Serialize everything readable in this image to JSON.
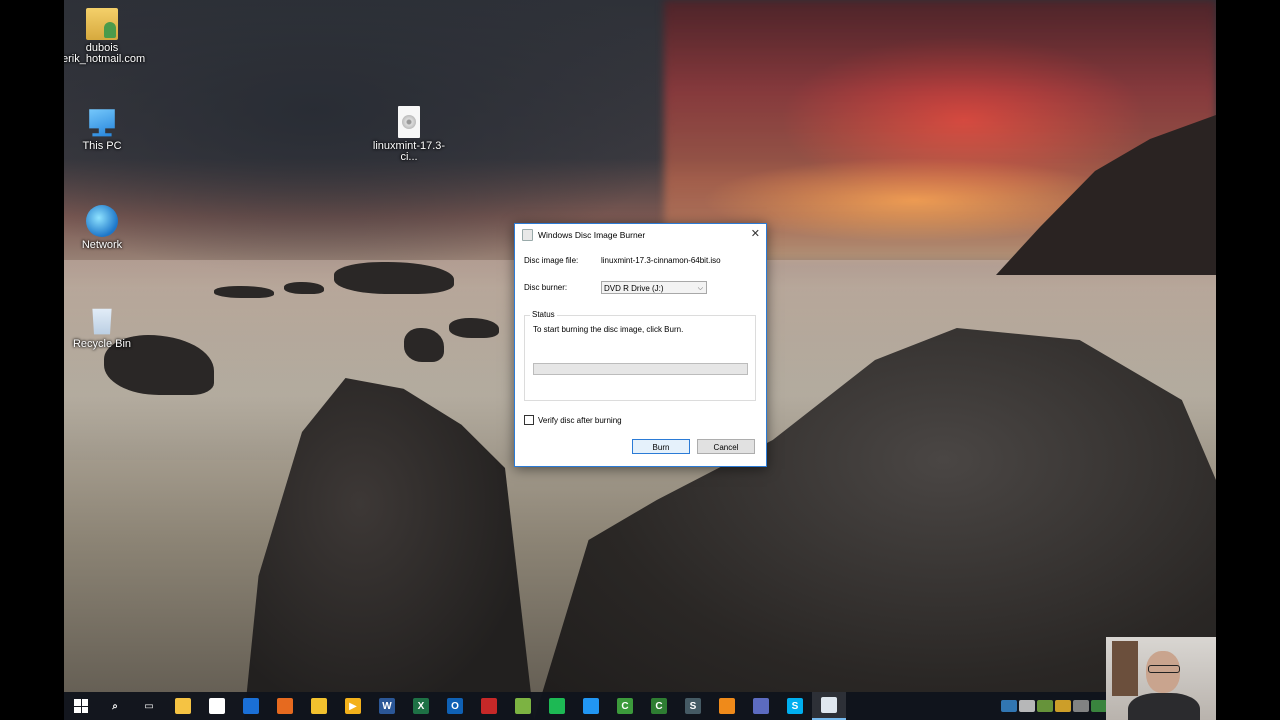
{
  "desktop": {
    "icons": [
      {
        "label": "dubois\nerik_hotmail.com",
        "line1": "dubois",
        "line2": "erik_hotmail.com",
        "icon": "user-folder-icon"
      },
      {
        "label": "This PC",
        "icon": "computer-icon"
      },
      {
        "label": "Network",
        "icon": "network-icon"
      },
      {
        "label": "Recycle Bin",
        "icon": "recycle-bin-icon"
      },
      {
        "label": "linuxmint-17.3-ci...",
        "icon": "disc-image-icon"
      }
    ]
  },
  "dialog": {
    "title": "Windows Disc Image Burner",
    "disc_image_label": "Disc image file:",
    "disc_image_value": "linuxmint-17.3-cinnamon-64bit.iso",
    "disc_burner_label": "Disc burner:",
    "disc_burner_value": "DVD R Drive (J:)",
    "status_label": "Status",
    "status_message": "To start burning the disc image, click Burn.",
    "progress_percent": 0,
    "verify_label": "Verify disc after burning",
    "verify_checked": false,
    "burn_label": "Burn",
    "cancel_label": "Cancel"
  },
  "taskbar": {
    "apps": [
      {
        "icon": "search-icon",
        "char": "⌕",
        "color": "transparent"
      },
      {
        "icon": "task-view-icon",
        "char": "▭",
        "color": "transparent"
      },
      {
        "icon": "file-explorer-icon",
        "char": "",
        "color": "#f5c343"
      },
      {
        "icon": "store-icon",
        "char": "",
        "color": "#ffffff"
      },
      {
        "icon": "teamviewer-icon",
        "char": "",
        "color": "#1a6fd6"
      },
      {
        "icon": "firefox-icon",
        "char": "",
        "color": "#e66a1f"
      },
      {
        "icon": "chrome-icon",
        "char": "",
        "color": "#f2c12e"
      },
      {
        "icon": "media-player-icon",
        "char": "▶",
        "color": "#f3b11b"
      },
      {
        "icon": "word-icon",
        "char": "W",
        "color": "#2b5797"
      },
      {
        "icon": "excel-icon",
        "char": "X",
        "color": "#1e7145"
      },
      {
        "icon": "outlook-icon",
        "char": "O",
        "color": "#0f61b5"
      },
      {
        "icon": "acrobat-icon",
        "char": "",
        "color": "#c62828"
      },
      {
        "icon": "notepad-plus-icon",
        "char": "",
        "color": "#7cb342"
      },
      {
        "icon": "spotify-icon",
        "char": "",
        "color": "#1db954"
      },
      {
        "icon": "wifi-app-icon",
        "char": "",
        "color": "#2196f3"
      },
      {
        "icon": "camtasia-icon",
        "char": "C",
        "color": "#3c9a3c"
      },
      {
        "icon": "camtasia-recorder-icon",
        "char": "C",
        "color": "#2e7d32"
      },
      {
        "icon": "app-s-icon",
        "char": "S",
        "color": "#455a64"
      },
      {
        "icon": "settings-app-icon",
        "char": "",
        "color": "#ef8a1a"
      },
      {
        "icon": "network-app-icon",
        "char": "",
        "color": "#5c6bc0"
      },
      {
        "icon": "skype-icon",
        "char": "S",
        "color": "#00aff0"
      },
      {
        "icon": "disc-burner-icon",
        "char": "",
        "color": "#dfe7ef"
      }
    ],
    "tray": [
      {
        "icon": "tray-app-1-icon",
        "color": "#3a8fd8"
      },
      {
        "icon": "tray-app-2-icon",
        "color": "#e0e0e0"
      },
      {
        "icon": "tray-app-3-icon",
        "color": "#7cb342"
      },
      {
        "icon": "tray-app-4-icon",
        "color": "#fbc02d"
      },
      {
        "icon": "tray-app-5-icon",
        "color": "#9e9e9e"
      },
      {
        "icon": "tray-app-6-icon",
        "color": "#43a047"
      },
      {
        "icon": "tray-app-7-icon",
        "color": "#e53935"
      },
      {
        "icon": "cloud-icon",
        "color": "#ffffff"
      },
      {
        "icon": "tray-app-8-icon",
        "color": "#8e24aa"
      },
      {
        "icon": "tray-app-9-icon",
        "color": "#26a69a"
      },
      {
        "icon": "airplane-icon",
        "color": "#ffffff"
      },
      {
        "icon": "battery-icon",
        "color": "#ffffff"
      }
    ]
  },
  "colors": {
    "accent": "#2b7bd6",
    "taskbar_bg": "#10141c"
  }
}
